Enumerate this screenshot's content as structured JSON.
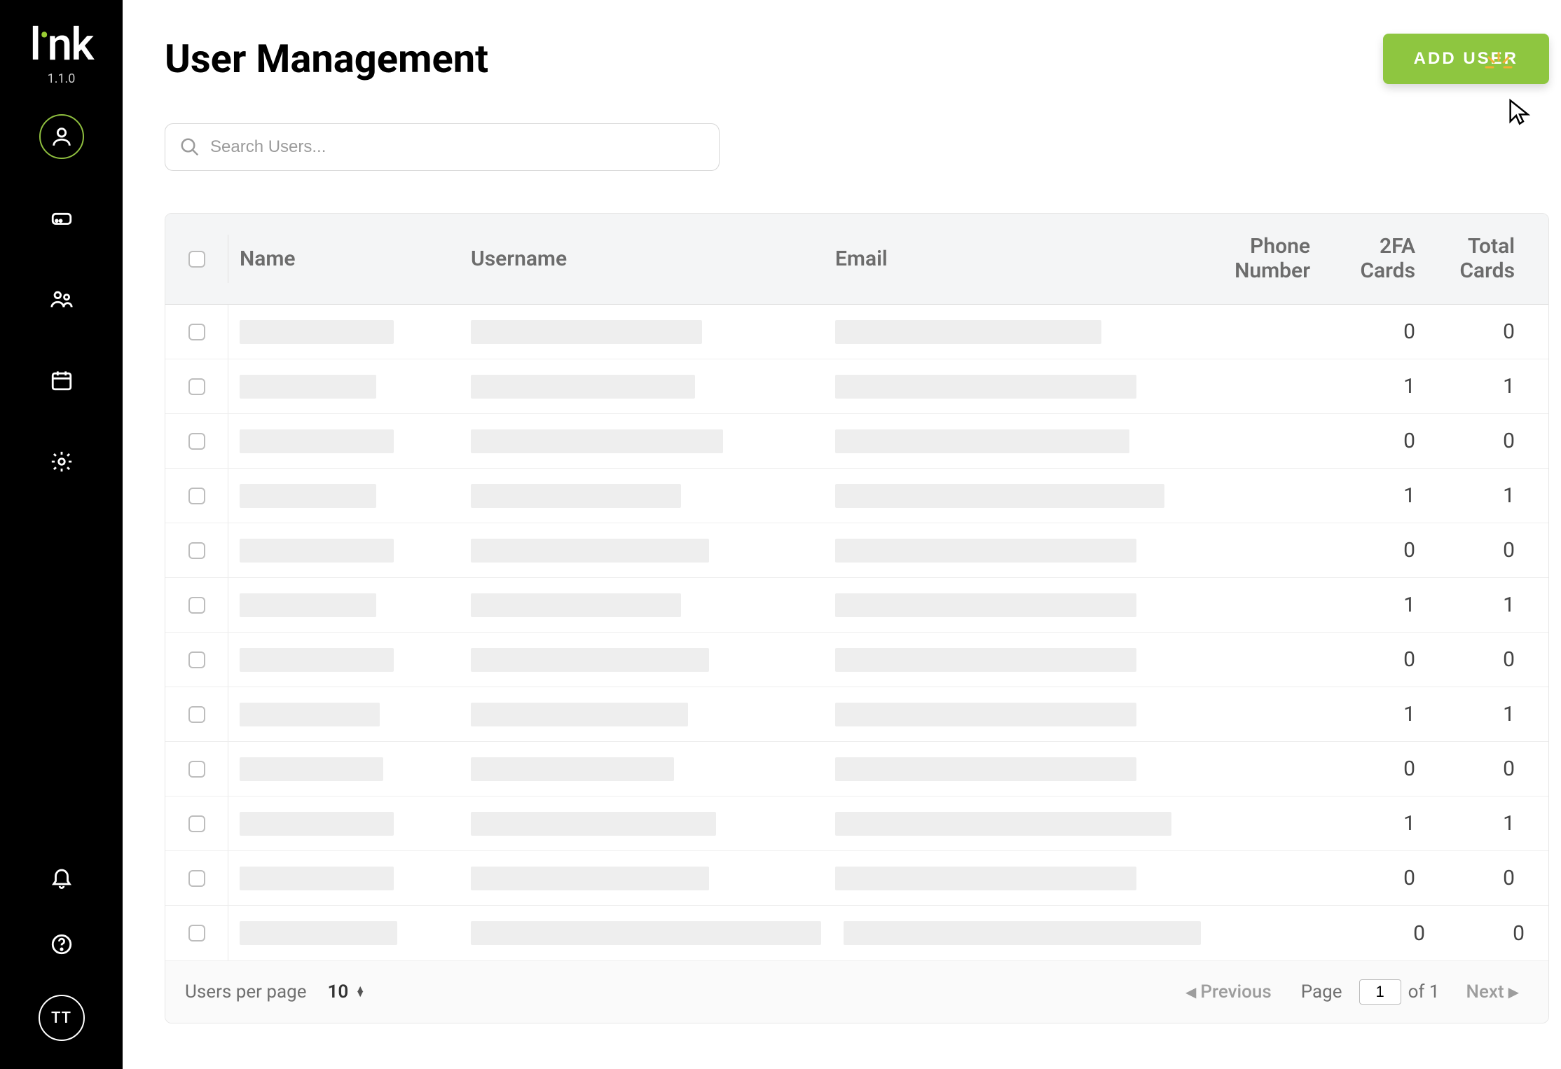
{
  "brand": {
    "name": "link",
    "version": "1.1.0"
  },
  "sidebar": {
    "items": [
      {
        "key": "users",
        "icon": "user-icon",
        "active": true
      },
      {
        "key": "storage",
        "icon": "drive-icon",
        "active": false
      },
      {
        "key": "groups",
        "icon": "people-icon",
        "active": false
      },
      {
        "key": "calendar",
        "icon": "calendar-icon",
        "active": false
      },
      {
        "key": "settings",
        "icon": "gear-icon",
        "active": false
      }
    ],
    "bottom": {
      "bell": "bell-icon",
      "help": "help-icon",
      "avatar_initials": "TT"
    }
  },
  "page": {
    "title": "User Management",
    "add_user_label": "ADD USER"
  },
  "search": {
    "placeholder": "Search Users..."
  },
  "table": {
    "headers": {
      "name": "Name",
      "username": "Username",
      "email": "Email",
      "phone_line1": "Phone",
      "phone_line2": "Number",
      "twofa_line1": "2FA",
      "twofa_line2": "Cards",
      "total_line1": "Total",
      "total_line2": "Cards"
    },
    "rows": [
      {
        "twofa": "0",
        "total": "0"
      },
      {
        "twofa": "1",
        "total": "1"
      },
      {
        "twofa": "0",
        "total": "0"
      },
      {
        "twofa": "1",
        "total": "1"
      },
      {
        "twofa": "0",
        "total": "0"
      },
      {
        "twofa": "1",
        "total": "1"
      },
      {
        "twofa": "0",
        "total": "0"
      },
      {
        "twofa": "1",
        "total": "1"
      },
      {
        "twofa": "0",
        "total": "0"
      },
      {
        "twofa": "1",
        "total": "1"
      },
      {
        "twofa": "0",
        "total": "0"
      },
      {
        "twofa": "0",
        "total": "0"
      }
    ]
  },
  "pagination": {
    "per_page_label": "Users per page",
    "per_page_value": "10",
    "previous_label": "Previous",
    "next_label": "Next",
    "page_label": "Page",
    "page_value": "1",
    "of_label": "of 1"
  }
}
